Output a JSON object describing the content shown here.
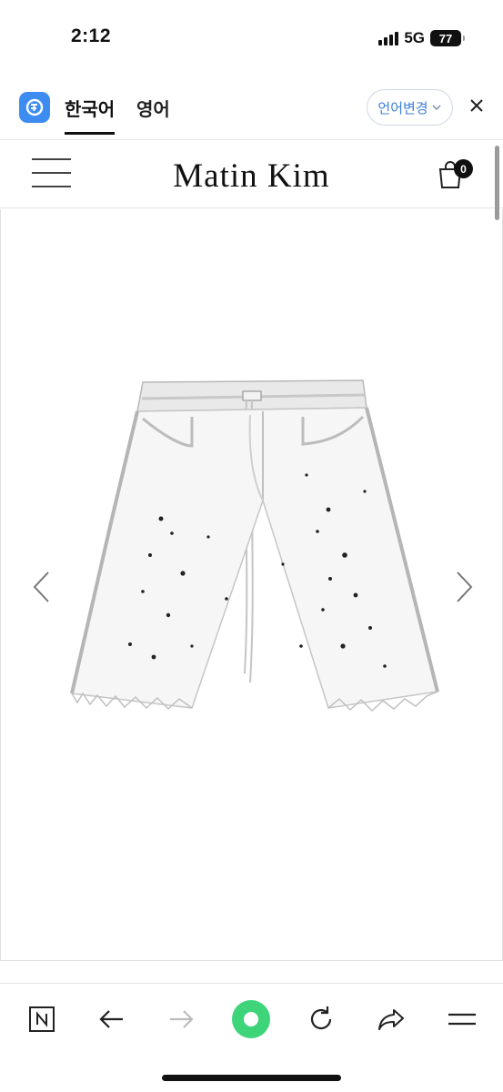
{
  "status_bar": {
    "time": "2:12",
    "network": "5G",
    "battery": "77"
  },
  "translate_bar": {
    "current_language": "한국어",
    "other_language": "영어",
    "change_language_label": "언어변경"
  },
  "site": {
    "title": "Matin Kim",
    "cart_count": "0"
  },
  "colors": {
    "translate_accent": "#3c8cf2",
    "link_blue": "#3b7fd8",
    "refresh_green": "#3ed47a"
  },
  "icons": {
    "translate": "translate-app-icon",
    "menu": "hamburger-icon",
    "cart": "shopping-bag-icon",
    "prev": "chevron-left-icon",
    "next": "chevron-right-icon",
    "toolbar": [
      "naver-n-icon",
      "back-arrow-icon",
      "forward-arrow-icon",
      "green-dot-icon",
      "refresh-icon",
      "share-icon",
      "menu-icon"
    ]
  }
}
